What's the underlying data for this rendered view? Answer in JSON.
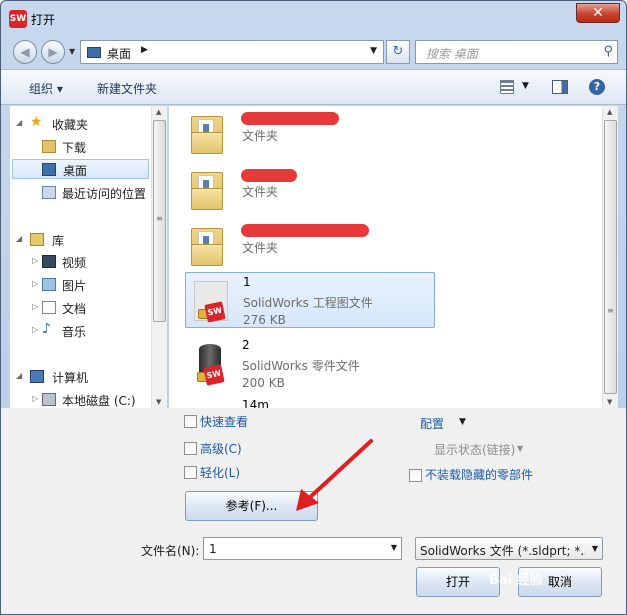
{
  "window": {
    "title": "打开",
    "icon": "SW",
    "close": "✕"
  },
  "nav": {
    "back": "◀",
    "forward": "▶",
    "address": "桌面",
    "search_placeholder": "搜索 桌面"
  },
  "toolbar": {
    "organize": "组织 ▾",
    "new_folder": "新建文件夹"
  },
  "navpane": {
    "items": [
      {
        "label": "收藏夹",
        "icon": "star-icon"
      },
      {
        "label": "下载",
        "icon": "download-folder-icon"
      },
      {
        "label": "桌面",
        "icon": "desktop-icon",
        "selected": true
      },
      {
        "label": "最近访问的位置",
        "icon": "recent-places-icon"
      },
      {
        "label": "库",
        "icon": "library-icon"
      },
      {
        "label": "视频",
        "icon": "video-icon"
      },
      {
        "label": "图片",
        "icon": "picture-icon"
      },
      {
        "label": "文档",
        "icon": "document-icon"
      },
      {
        "label": "音乐",
        "icon": "music-icon"
      },
      {
        "label": "计算机",
        "icon": "computer-icon"
      },
      {
        "label": "本地磁盘 (C:)",
        "icon": "disk-icon"
      }
    ]
  },
  "files": [
    {
      "name": "",
      "type": "文件夹",
      "size": "",
      "icon": "folder-icon"
    },
    {
      "name": "",
      "type": "文件夹",
      "size": "",
      "icon": "folder-icon"
    },
    {
      "name": "",
      "type": "文件夹",
      "size": "",
      "icon": "folder-icon"
    },
    {
      "name": "1",
      "type": "SolidWorks 工程图文件",
      "size": "276 KB",
      "icon": "solidworks-drawing-icon",
      "selected": true
    },
    {
      "name": "2",
      "type": "SolidWorks 零件文件",
      "size": "200 KB",
      "icon": "solidworks-part-icon"
    },
    {
      "name": "14m",
      "type": "",
      "size": "",
      "icon": "file-icon"
    }
  ],
  "options": {
    "quick_view": "快速查看",
    "advanced": "高级(C)",
    "lightweight": "轻化(L)",
    "configuration": "配置",
    "display_state": "显示状态(链接)",
    "dont_load_hidden": "不装载隐藏的零部件",
    "reference_button": "参考(F)...",
    "filename_label": "文件名(N):",
    "filename_value": "1",
    "filetype_value": "SolidWorks 文件 (*.sldprt; *.sl",
    "open_button": "打开",
    "cancel_button": "取消"
  },
  "watermark": "Bai 经验"
}
